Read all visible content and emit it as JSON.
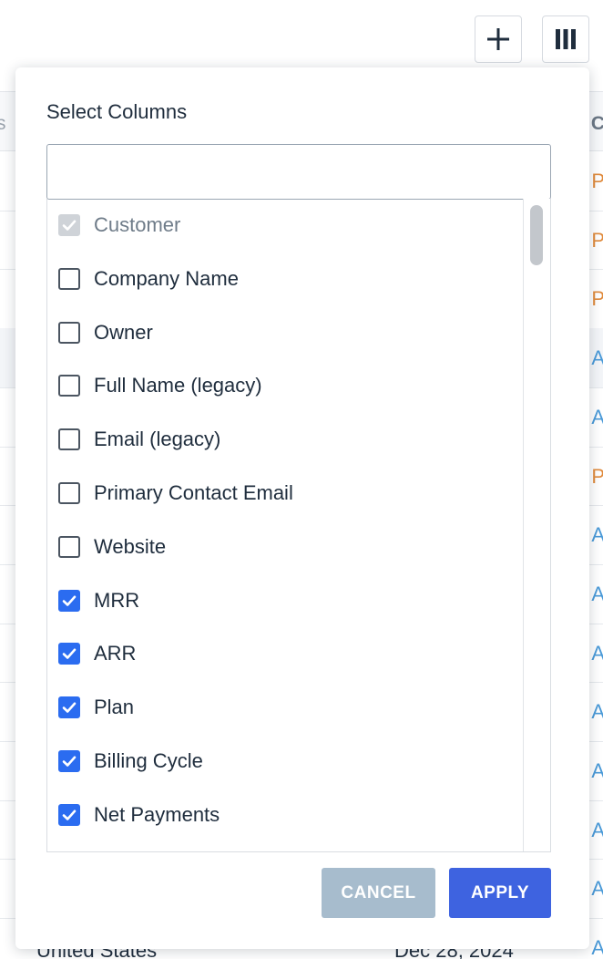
{
  "toolbar": {
    "add_icon": "plus-icon",
    "columns_icon": "columns-icon"
  },
  "background": {
    "header_letter": "C",
    "header_left_glyph": "s",
    "row_letters": [
      {
        "text": "P",
        "color": "#e08a3c"
      },
      {
        "text": "P",
        "color": "#e08a3c"
      },
      {
        "text": "P",
        "color": "#e08a3c"
      },
      {
        "text": "A",
        "color": "#4a9ad8"
      },
      {
        "text": "A",
        "color": "#4a9ad8"
      },
      {
        "text": "P",
        "color": "#e08a3c"
      },
      {
        "text": "A",
        "color": "#4a9ad8"
      },
      {
        "text": "A",
        "color": "#4a9ad8"
      },
      {
        "text": "A",
        "color": "#4a9ad8"
      },
      {
        "text": "A",
        "color": "#4a9ad8"
      },
      {
        "text": "A",
        "color": "#4a9ad8"
      },
      {
        "text": "A",
        "color": "#4a9ad8"
      },
      {
        "text": "A",
        "color": "#4a9ad8"
      },
      {
        "text": "A",
        "color": "#4a9ad8"
      }
    ],
    "bottom_country": "United States",
    "bottom_date": "Dec 28, 2024"
  },
  "popover": {
    "title": "Select Columns",
    "search": {
      "value": "",
      "placeholder": ""
    },
    "items": [
      {
        "label": "Customer",
        "checked": true,
        "disabled": true
      },
      {
        "label": "Company Name",
        "checked": false,
        "disabled": false
      },
      {
        "label": "Owner",
        "checked": false,
        "disabled": false
      },
      {
        "label": "Full Name (legacy)",
        "checked": false,
        "disabled": false
      },
      {
        "label": "Email (legacy)",
        "checked": false,
        "disabled": false
      },
      {
        "label": "Primary Contact Email",
        "checked": false,
        "disabled": false
      },
      {
        "label": "Website",
        "checked": false,
        "disabled": false
      },
      {
        "label": "MRR",
        "checked": true,
        "disabled": false
      },
      {
        "label": "ARR",
        "checked": true,
        "disabled": false
      },
      {
        "label": "Plan",
        "checked": true,
        "disabled": false
      },
      {
        "label": "Billing Cycle",
        "checked": true,
        "disabled": false
      },
      {
        "label": "Net Payments",
        "checked": true,
        "disabled": false
      }
    ],
    "cancel_label": "CANCEL",
    "apply_label": "APPLY"
  },
  "colors": {
    "accent": "#3e63e0",
    "checkbox_checked": "#2b6cf0",
    "cancel_disabled": "#a7bccd"
  }
}
